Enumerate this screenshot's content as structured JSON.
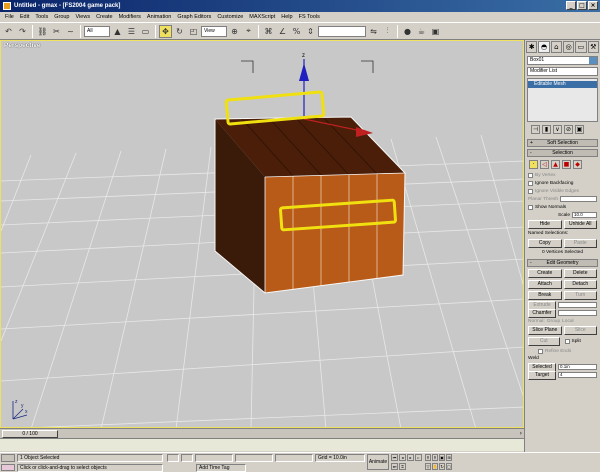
{
  "window": {
    "title": "Untitled - gmax - [FS2004 game pack]",
    "buttons": [
      "_",
      "□",
      "×"
    ]
  },
  "menubar": [
    "File",
    "Edit",
    "Tools",
    "Group",
    "Views",
    "Create",
    "Modifiers",
    "Animation",
    "Graph Editors",
    "Customize",
    "MAXScript",
    "Help",
    "FS Tools"
  ],
  "toolbar": {
    "selection_filter": "All",
    "coord_system": "View",
    "named_selection": ""
  },
  "viewport": {
    "label": "Perspective",
    "axis_z": "z",
    "axis_x": "x",
    "axis_y": "y"
  },
  "command_panel": {
    "object_name": "Box01",
    "modifier_list": "Modifier List",
    "stack_item": "Editable Mesh",
    "soft_selection": "Soft Selection",
    "selection_title": "Selection",
    "by_vertex": "By Vertex",
    "ignore_backfacing": "Ignore Backfacing",
    "ignore_visible_edges": "Ignore Visible Edges",
    "planar_thresh": "Planar Thresh",
    "show_normals": "Show Normals",
    "scale_label": "Scale",
    "scale_value": "10.0",
    "hide": "Hide",
    "unhide_all": "Unhide All",
    "named_selections": "Named Selections:",
    "copy": "Copy",
    "paste": "Paste",
    "selection_status": "0 Vertices Selected",
    "edit_geometry": "Edit Geometry",
    "create": "Create",
    "delete": "Delete",
    "attach": "Attach",
    "detach": "Detach",
    "break": "Break",
    "turn": "Turn",
    "extrude": "Extrude",
    "chamfer": "Chamfer",
    "normal_label": "Normal:",
    "group": "Group",
    "local": "Local",
    "slice_plane": "Slice Plane",
    "slice": "Slice",
    "cut": "Cut",
    "split": "Split",
    "refine_ends": "Refine Ends",
    "weld": "Weld",
    "selected": "Selected",
    "selected_value": "0.1in",
    "target": "Target",
    "target_value": "4"
  },
  "time_slider": {
    "frame": "0 / 100"
  },
  "status": {
    "selection": "1 Object Selected",
    "prompt": "Click or click-and-drag to select objects",
    "add_time_tag": "Add Time Tag",
    "x_value": "",
    "y_value": "",
    "z_value": "",
    "grid": "Grid = 10.0in",
    "animate": "Animate"
  },
  "colors": {
    "viewport_bg": "#c8c8c8",
    "box_front": "#b85a18",
    "box_side": "#3a1a08",
    "box_top": "#4a1e08",
    "highlight": "#f0e010",
    "titlebar": "#0a246a"
  }
}
